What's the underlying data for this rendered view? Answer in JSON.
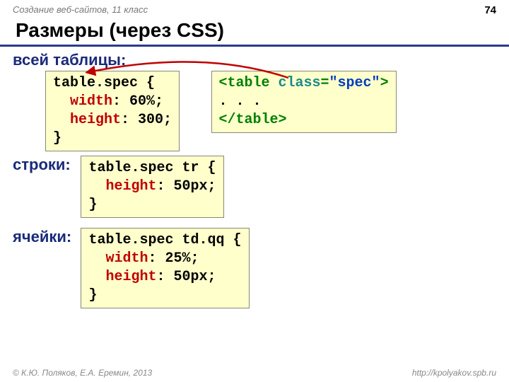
{
  "header": {
    "course": "Создание веб-сайтов, 11 класс",
    "page_number": "74"
  },
  "title": "Размеры (через CSS)",
  "sections": {
    "whole_table": "всей таблицы:",
    "row": "строки:",
    "cell": "ячейки:"
  },
  "code1": {
    "sel": "table.spec {",
    "p1a": "width",
    "p1b": ": 60%;",
    "p2a": "height",
    "p2b": ": 300;",
    "close": "}"
  },
  "code_html": {
    "open_a": "<table ",
    "open_b": "class",
    "open_c": "=",
    "open_d": "\"spec\"",
    "open_e": ">",
    "mid": ". . .",
    "close": "</table>"
  },
  "code2": {
    "sel": "table.spec tr {",
    "p1a": "height",
    "p1b": ": 50px;",
    "close": "}"
  },
  "code3": {
    "sel": "table.spec td.qq {",
    "p1a": "width",
    "p1b": ": 25%;",
    "p2a": "height",
    "p2b": ": 50px;",
    "close": "}"
  },
  "footer": {
    "copyright": "© К.Ю. Поляков, Е.А. Еремин, 2013",
    "url": "http://kpolyakov.spb.ru"
  }
}
